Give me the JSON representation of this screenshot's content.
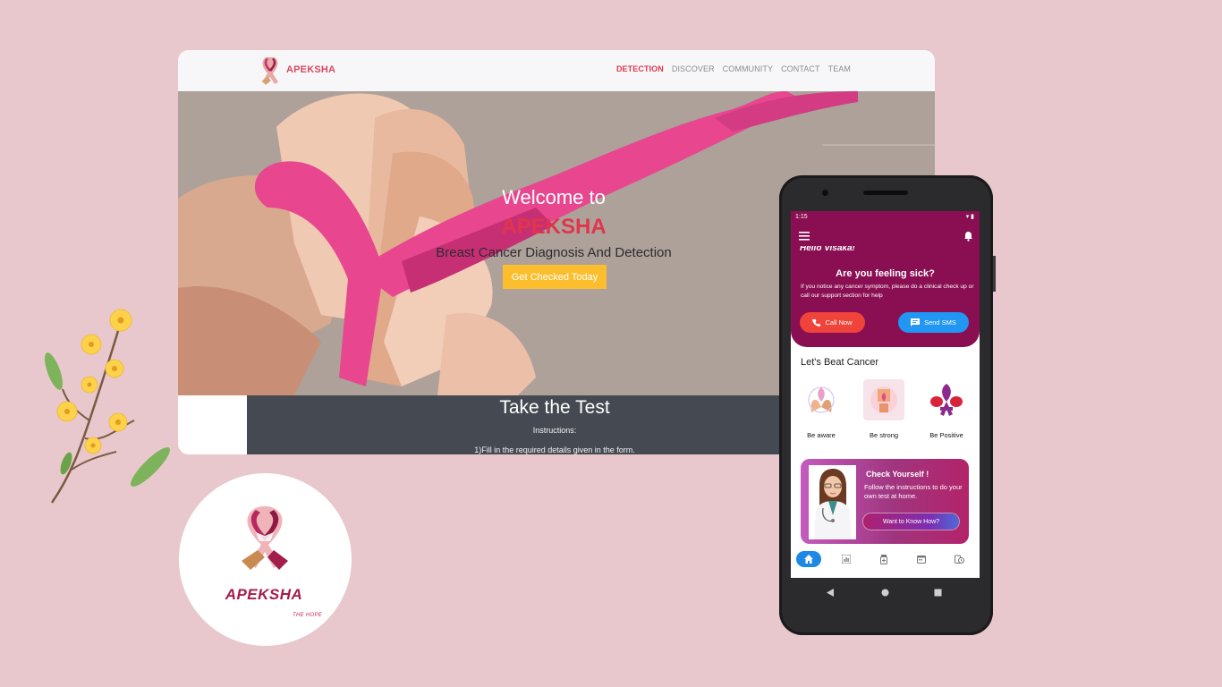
{
  "website": {
    "brand": "APEKSHA",
    "nav": [
      {
        "label": "DETECTION",
        "active": true
      },
      {
        "label": "DISCOVER",
        "active": false
      },
      {
        "label": "COMMUNITY",
        "active": false
      },
      {
        "label": "CONTACT",
        "active": false
      },
      {
        "label": "TEAM",
        "active": false
      }
    ],
    "hero": {
      "welcome": "Welcome to",
      "title": "APEKSHA",
      "subtitle": "Breast Cancer Diagnosis And Detection",
      "cta": "Get Checked Today"
    },
    "test": {
      "title": "Take the Test",
      "instructions": "Instructions:",
      "step1": "1)Fill in the required details given in the form."
    }
  },
  "logo_badge": {
    "name": "APEKSHA",
    "tagline": "THE HOPE"
  },
  "phone": {
    "status_time": "1:15",
    "greeting": "Hello Visaka!",
    "sick_card": {
      "title": "Are you feeling sick?",
      "text": "If you notice any cancer symptom, please do a clinical check up or call our support section for help",
      "call_button": "Call Now",
      "sms_button": "Send SMS"
    },
    "section_title": "Let's Beat Cancer",
    "tiles": [
      {
        "label": "Be aware",
        "icon": "hands-ribbon-icon"
      },
      {
        "label": "Be strong",
        "icon": "fist-ribbon-icon"
      },
      {
        "label": "Be Positive",
        "icon": "ribbon-gloves-icon"
      }
    ],
    "check_card": {
      "title": "Check Yourself !",
      "text": "Follow the instructions to do your own test at home.",
      "button": "Want to Know How?"
    },
    "bottom_nav": [
      {
        "icon": "home-icon",
        "active": true
      },
      {
        "icon": "chart-icon",
        "active": false
      },
      {
        "icon": "medicine-icon",
        "active": false
      },
      {
        "icon": "calendar-icon",
        "active": false
      },
      {
        "icon": "history-icon",
        "active": false
      }
    ]
  },
  "colors": {
    "background": "#e8c8cd",
    "brand_pink": "#e1354c",
    "app_primary": "#8a0e52",
    "cta_yellow": "#fdbe2e",
    "call_red": "#f0433a",
    "sms_blue": "#2196f3"
  }
}
